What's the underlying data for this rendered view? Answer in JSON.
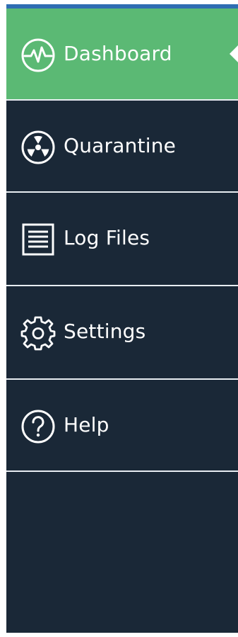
{
  "sidebar": {
    "items": [
      {
        "label": "Dashboard",
        "icon": "pulse-icon",
        "active": true
      },
      {
        "label": "Quarantine",
        "icon": "radiation-icon",
        "active": false
      },
      {
        "label": "Log Files",
        "icon": "log-file-icon",
        "active": false
      },
      {
        "label": "Settings",
        "icon": "gear-icon",
        "active": false
      },
      {
        "label": "Help",
        "icon": "help-icon",
        "active": false
      }
    ]
  },
  "colors": {
    "sidebar_bg": "#1a2837",
    "active_bg": "#5bb974",
    "accent_line": "#2e6db2",
    "text": "#ffffff",
    "divider": "#e8edf2"
  }
}
